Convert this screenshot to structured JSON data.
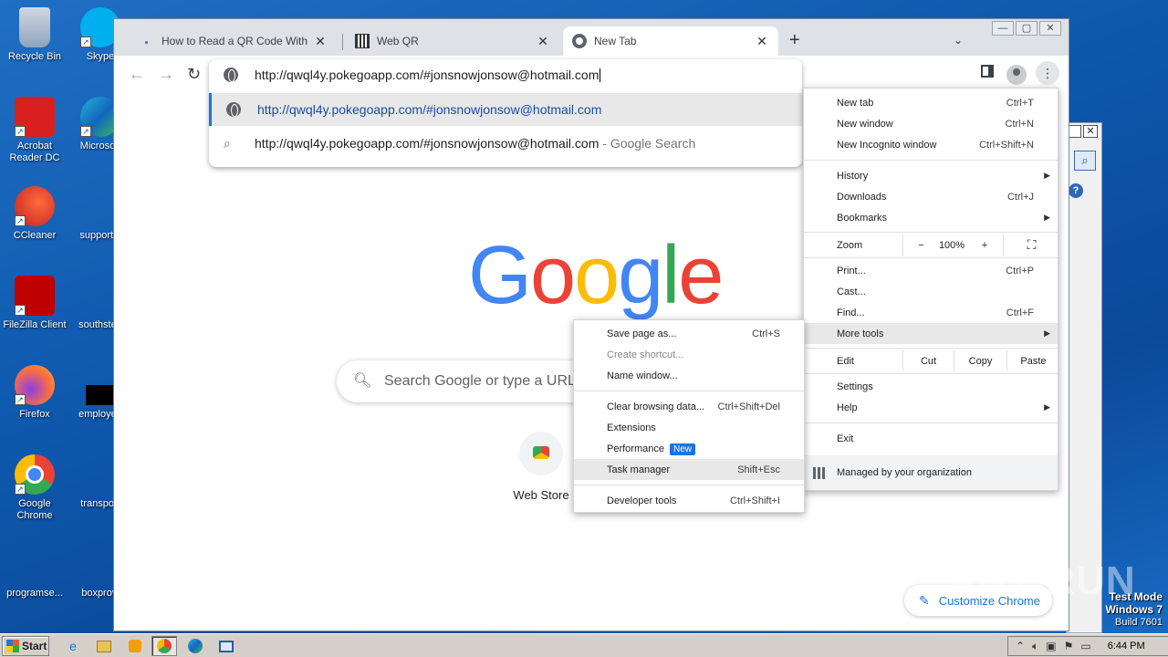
{
  "desktop": {
    "icons": [
      {
        "label": "Recycle Bin"
      },
      {
        "label": "Skype"
      },
      {
        "label": "Acrobat Reader DC"
      },
      {
        "label": "Microsoft"
      },
      {
        "label": "CCleaner"
      },
      {
        "label": "supportal"
      },
      {
        "label": "FileZilla Client"
      },
      {
        "label": "southstep"
      },
      {
        "label": "Firefox"
      },
      {
        "label": "employee"
      },
      {
        "label": "Google Chrome"
      },
      {
        "label": "transport"
      },
      {
        "label": "programse..."
      },
      {
        "label": "boxprovi"
      }
    ],
    "watermark": "ANY RUN",
    "test_mode": {
      "line1": "Test Mode",
      "line2": "Windows 7",
      "line3": "Build 7601"
    }
  },
  "chrome": {
    "tabs": [
      {
        "title": "How to Read a QR Code Without a C",
        "close": "✕"
      },
      {
        "title": "Web QR",
        "close": "✕"
      },
      {
        "title": "New Tab",
        "close": "✕"
      }
    ],
    "window_controls": {
      "minimize": "—",
      "maximize": "▢",
      "close": "✕"
    },
    "omnibox": {
      "value": "http://qwql4y.pokegoapp.com/#jonsnowjonsow@hotmail.com",
      "suggestions": [
        {
          "text": "http://qwql4y.pokegoapp.com/#jonsnowjonsow@hotmail.com",
          "suffix": ""
        },
        {
          "text": "http://qwql4y.pokegoapp.com/#jonsnowjonsow@hotmail.com",
          "suffix": " - Google Search"
        }
      ]
    },
    "newtab": {
      "logo": [
        "G",
        "o",
        "o",
        "g",
        "l",
        "e"
      ],
      "logo_colors": [
        "#4285f4",
        "#ea4335",
        "#fbbc05",
        "#4285f4",
        "#34a853",
        "#ea4335"
      ],
      "search_placeholder": "Search Google or type a URL",
      "shortcut_label": "Web Store",
      "customize_label": "Customize Chrome"
    },
    "main_menu": {
      "new_tab": {
        "label": "New tab",
        "shortcut": "Ctrl+T"
      },
      "new_window": {
        "label": "New window",
        "shortcut": "Ctrl+N"
      },
      "new_incognito": {
        "label": "New Incognito window",
        "shortcut": "Ctrl+Shift+N"
      },
      "history": {
        "label": "History"
      },
      "downloads": {
        "label": "Downloads",
        "shortcut": "Ctrl+J"
      },
      "bookmarks": {
        "label": "Bookmarks"
      },
      "zoom": {
        "label": "Zoom",
        "minus": "−",
        "value": "100%",
        "plus": "+"
      },
      "print": {
        "label": "Print...",
        "shortcut": "Ctrl+P"
      },
      "cast": {
        "label": "Cast..."
      },
      "find": {
        "label": "Find...",
        "shortcut": "Ctrl+F"
      },
      "more_tools": {
        "label": "More tools"
      },
      "edit": {
        "label": "Edit",
        "cut": "Cut",
        "copy": "Copy",
        "paste": "Paste"
      },
      "settings": {
        "label": "Settings"
      },
      "help": {
        "label": "Help"
      },
      "exit": {
        "label": "Exit"
      },
      "managed": {
        "label": "Managed by your organization"
      }
    },
    "more_tools_menu": {
      "save_page": {
        "label": "Save page as...",
        "shortcut": "Ctrl+S"
      },
      "create_shortcut": {
        "label": "Create shortcut..."
      },
      "name_window": {
        "label": "Name window..."
      },
      "clear_data": {
        "label": "Clear browsing data...",
        "shortcut": "Ctrl+Shift+Del"
      },
      "extensions": {
        "label": "Extensions"
      },
      "performance": {
        "label": "Performance",
        "badge": "New"
      },
      "task_manager": {
        "label": "Task manager",
        "shortcut": "Shift+Esc"
      },
      "dev_tools": {
        "label": "Developer tools",
        "shortcut": "Ctrl+Shift+I"
      }
    }
  },
  "taskbar": {
    "start_label": "Start",
    "clock": "6:44 PM"
  },
  "colors": {
    "accent": "#1a73e8",
    "desktop_bg": "#0e58ad",
    "tab_strip": "#dee1e6"
  }
}
